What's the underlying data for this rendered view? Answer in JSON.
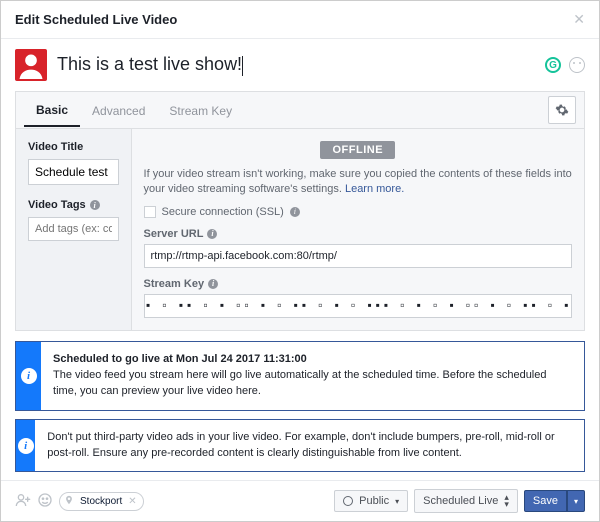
{
  "dialog": {
    "title": "Edit Scheduled Live Video"
  },
  "compose": {
    "text": "This is a test live show!"
  },
  "tabs": {
    "basic": "Basic",
    "advanced": "Advanced",
    "stream_key": "Stream Key"
  },
  "left": {
    "title_label": "Video Title",
    "title_value": "Schedule test",
    "tags_label": "Video Tags",
    "tags_placeholder": "Add tags (ex: comedy, animals, make-up etc."
  },
  "right": {
    "status_badge": "OFFLINE",
    "help_text": "If your video stream isn't working, make sure you copied the contents of these fields into your video streaming software's settings. ",
    "help_link": "Learn more.",
    "ssl_label": "Secure connection (SSL)",
    "server_label": "Server URL",
    "server_value": "rtmp://rtmp-api.facebook.com:80/rtmp/",
    "key_label": "Stream Key"
  },
  "callout1": {
    "heading": "Scheduled to go live at Mon Jul 24 2017 11:31:00",
    "body": "The video feed you stream here will go live automatically at the scheduled time. Before the scheduled time, you can preview your live video here."
  },
  "callout2": {
    "body": "Don't put third-party video ads in your live video. For example, don't include bumpers, pre-roll, mid-roll or post-roll. Ensure any pre-recorded content is clearly distinguishable from live content."
  },
  "footer": {
    "location": "Stockport",
    "privacy": "Public",
    "status": "Scheduled Live",
    "save": "Save"
  }
}
